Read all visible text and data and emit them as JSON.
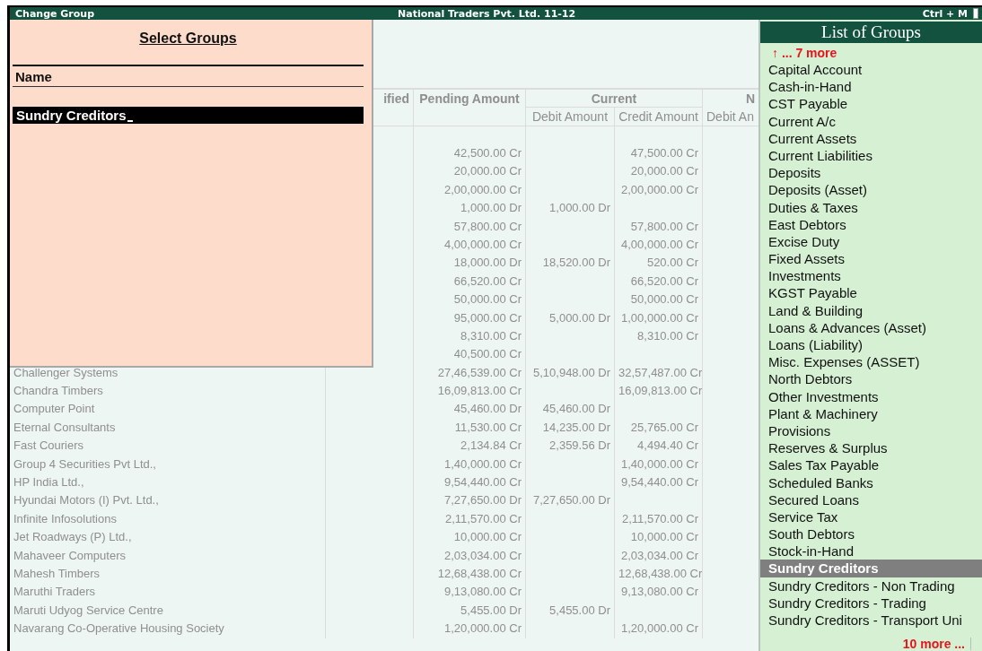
{
  "title_bar": {
    "title": "Change Group",
    "company": "National Traders Pvt. Ltd. 11-12",
    "shortcut": "Ctrl + M"
  },
  "ledger_table": {
    "header": {
      "column_2": "ified",
      "pending": "Pending Amount",
      "current": "Current",
      "current_debit": "Debit Amount",
      "current_credit": "Credit Amount",
      "column_6": "N",
      "column_6_debit": "Debit An"
    },
    "rows": [
      {
        "pending": "42,500.00 Cr",
        "credit": "47,500.00 Cr"
      },
      {
        "pending": "20,000.00 Cr",
        "credit": "20,000.00 Cr"
      },
      {
        "pending": "2,00,000.00 Cr",
        "credit": "2,00,000.00 Cr"
      },
      {
        "pending": "1,000.00 Dr",
        "debit": "1,000.00 Dr"
      },
      {
        "pending": "57,800.00 Cr",
        "credit": "57,800.00 Cr"
      },
      {
        "pending": "4,00,000.00 Cr",
        "credit": "4,00,000.00 Cr"
      },
      {
        "pending": "18,000.00 Dr",
        "debit": "18,520.00 Dr",
        "credit": "520.00 Cr"
      },
      {
        "pending": "66,520.00 Cr",
        "credit": "66,520.00 Cr"
      },
      {
        "pending": "50,000.00 Cr",
        "credit": "50,000.00 Cr"
      },
      {
        "pending": "95,000.00 Cr",
        "debit": "5,000.00 Dr",
        "credit": "1,00,000.00 Cr"
      },
      {
        "pending": "8,310.00 Cr",
        "credit": "8,310.00 Cr"
      },
      {
        "pending": "40,500.00 Cr"
      },
      {
        "name": "Challenger Systems",
        "pending": "27,46,539.00 Cr",
        "debit": "5,10,948.00 Dr",
        "credit": "32,57,487.00 Cr"
      },
      {
        "name": "Chandra Timbers",
        "pending": "16,09,813.00 Cr",
        "credit": "16,09,813.00 Cr"
      },
      {
        "name": "Computer Point",
        "pending": "45,460.00 Dr",
        "debit": "45,460.00 Dr"
      },
      {
        "name": "Eternal Consultants",
        "pending": "11,530.00 Cr",
        "debit": "14,235.00 Dr",
        "credit": "25,765.00 Cr"
      },
      {
        "name": "Fast Couriers",
        "pending": "2,134.84 Cr",
        "debit": "2,359.56 Dr",
        "credit": "4,494.40 Cr"
      },
      {
        "name": "Group 4 Securities Pvt Ltd.,",
        "pending": "1,40,000.00 Cr",
        "credit": "1,40,000.00 Cr"
      },
      {
        "name": "HP India Ltd.,",
        "pending": "9,54,440.00 Cr",
        "credit": "9,54,440.00 Cr"
      },
      {
        "name": "Hyundai Motors (I) Pvt. Ltd.,",
        "pending": "7,27,650.00 Dr",
        "debit": "7,27,650.00 Dr"
      },
      {
        "name": "Infinite Infosolutions",
        "pending": "2,11,570.00 Cr",
        "credit": "2,11,570.00 Cr"
      },
      {
        "name": "Jet Roadways (P) Ltd.,",
        "pending": "10,000.00 Cr",
        "credit": "10,000.00 Cr"
      },
      {
        "name": "Mahaveer Computers",
        "pending": "2,03,034.00 Cr",
        "credit": "2,03,034.00 Cr"
      },
      {
        "name": "Mahesh Timbers",
        "pending": "12,68,438.00 Cr",
        "credit": "12,68,438.00 Cr"
      },
      {
        "name": "Maruthi Traders",
        "pending": "9,13,080.00 Cr",
        "credit": "9,13,080.00 Cr"
      },
      {
        "name": "Maruti Udyog Service Centre",
        "pending": "5,455.00 Dr",
        "debit": "5,455.00 Dr"
      },
      {
        "name": "Navarang Co-Operative Housing Society",
        "pending": "1,20,000.00 Cr",
        "credit": "1,20,000.00 Cr"
      }
    ]
  },
  "select_dialog": {
    "title": "Select Groups",
    "column": "Name",
    "value": "Sundry Creditors"
  },
  "group_list": {
    "title": "List of Groups",
    "more_above": "↑ ... 7 more",
    "items": [
      {
        "label": "Capital Account",
        "selected": false
      },
      {
        "label": "Cash-in-Hand",
        "selected": false
      },
      {
        "label": "CST Payable",
        "selected": false
      },
      {
        "label": "Current A/c",
        "selected": false
      },
      {
        "label": "Current Assets",
        "selected": false
      },
      {
        "label": "Current Liabilities",
        "selected": false
      },
      {
        "label": "Deposits",
        "selected": false
      },
      {
        "label": "Deposits (Asset)",
        "selected": false
      },
      {
        "label": "Duties & Taxes",
        "selected": false
      },
      {
        "label": "East Debtors",
        "selected": false
      },
      {
        "label": "Excise Duty",
        "selected": false
      },
      {
        "label": "Fixed Assets",
        "selected": false
      },
      {
        "label": "Investments",
        "selected": false
      },
      {
        "label": "KGST Payable",
        "selected": false
      },
      {
        "label": "Land & Building",
        "selected": false
      },
      {
        "label": "Loans & Advances (Asset)",
        "selected": false
      },
      {
        "label": "Loans (Liability)",
        "selected": false
      },
      {
        "label": "Misc. Expenses (ASSET)",
        "selected": false
      },
      {
        "label": "North Debtors",
        "selected": false
      },
      {
        "label": "Other Investments",
        "selected": false
      },
      {
        "label": "Plant & Machinery",
        "selected": false
      },
      {
        "label": "Provisions",
        "selected": false
      },
      {
        "label": "Reserves & Surplus",
        "selected": false
      },
      {
        "label": "Sales Tax Payable",
        "selected": false
      },
      {
        "label": "Scheduled Banks",
        "selected": false
      },
      {
        "label": "Secured Loans",
        "selected": false
      },
      {
        "label": "Service Tax",
        "selected": false
      },
      {
        "label": "South Debtors",
        "selected": false
      },
      {
        "label": "Stock-in-Hand",
        "selected": false
      },
      {
        "label": "Sundry Creditors",
        "selected": true
      },
      {
        "label": "Sundry Creditors - Non Trading",
        "selected": false
      },
      {
        "label": "Sundry Creditors - Trading",
        "selected": false
      },
      {
        "label": "Sundry Creditors - Transport Uni",
        "selected": false
      }
    ],
    "more_below": "10 more ..."
  }
}
